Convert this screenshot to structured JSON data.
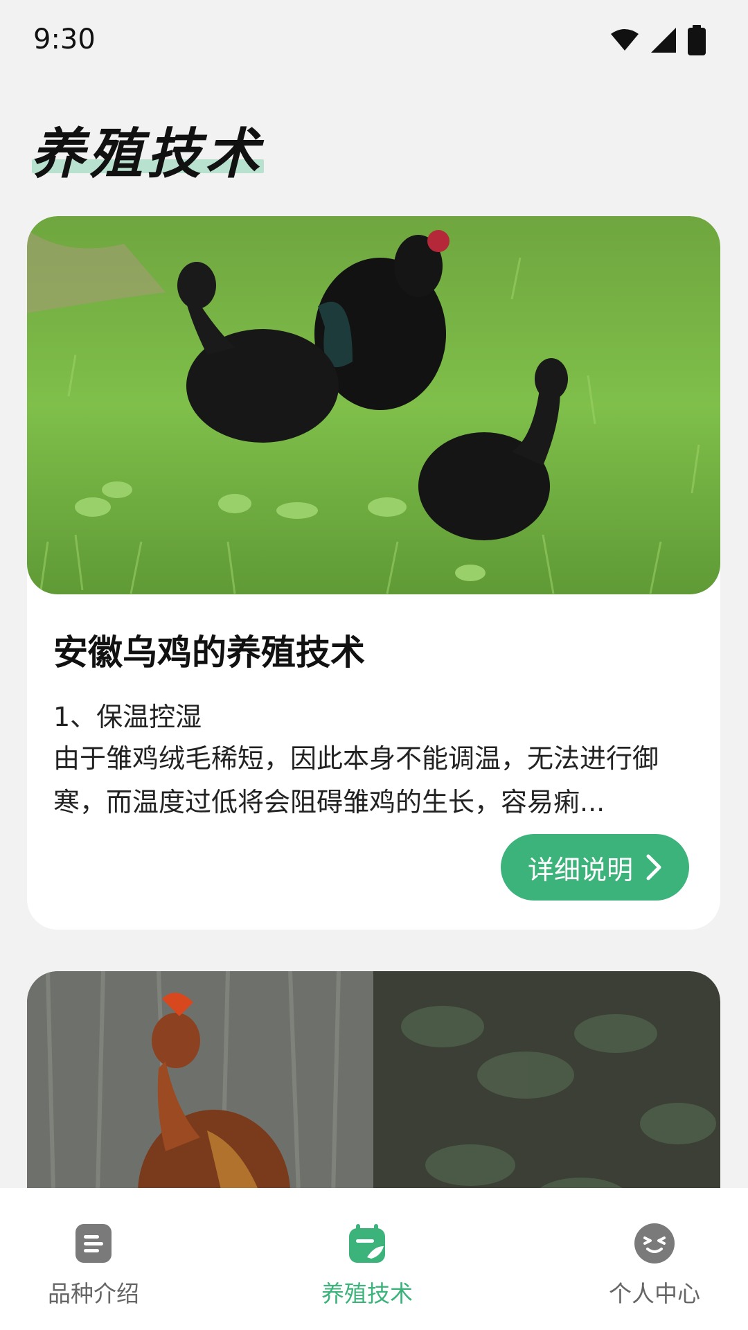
{
  "status_bar": {
    "time": "9:30"
  },
  "page": {
    "title": "养殖技术"
  },
  "cards": [
    {
      "title": "安徽乌鸡的养殖技术",
      "subtitle": "1、保温控湿",
      "description": "由于雏鸡绒毛稀短，因此本身不能调温，无法进行御寒，而温度过低将会阻碍雏鸡的生长，容易痢...",
      "button_label": "详细说明"
    }
  ],
  "bottom_nav": {
    "items": [
      {
        "label": "品种介绍",
        "icon": "document-icon",
        "active": false
      },
      {
        "label": "养殖技术",
        "icon": "calendar-icon",
        "active": true
      },
      {
        "label": "个人中心",
        "icon": "smiley-icon",
        "active": false
      }
    ]
  },
  "colors": {
    "accent": "#3cb37a",
    "background": "#f2f2f2",
    "card": "#ffffff",
    "inactive": "#666666"
  }
}
